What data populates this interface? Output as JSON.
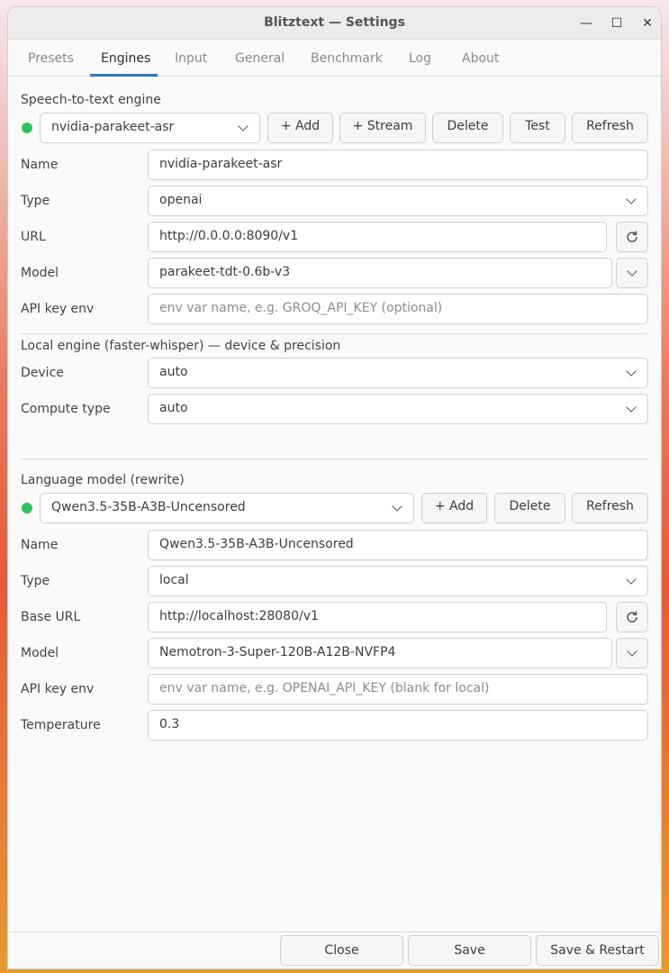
{
  "window": {
    "title": "Blitztext — Settings",
    "min_glyph": "—",
    "max_glyph": "☐",
    "close_glyph": "✕"
  },
  "tabs": [
    {
      "label": "Presets"
    },
    {
      "label": "Engines"
    },
    {
      "label": "Input"
    },
    {
      "label": "General"
    },
    {
      "label": "Benchmark"
    },
    {
      "label": "Log"
    },
    {
      "label": "About"
    }
  ],
  "stt": {
    "title": "Speech-to-text engine",
    "status_color": "#2fc35b",
    "selected": "nvidia-parakeet-asr",
    "buttons": {
      "add": "+ Add",
      "stream": "+ Stream",
      "delete": "Delete",
      "test": "Test",
      "refresh": "Refresh"
    },
    "name_label": "Name",
    "name_value": "nvidia-parakeet-asr",
    "type_label": "Type",
    "type_value": "openai",
    "url_label": "URL",
    "url_value": "http://0.0.0.0:8090/v1",
    "model_label": "Model",
    "model_value": "parakeet-tdt-0.6b-v3",
    "apikey_label": "API key env",
    "apikey_placeholder": "env var name, e.g. GROQ_API_KEY  (optional)"
  },
  "local": {
    "title": "Local engine (faster-whisper) — device & precision",
    "device_label": "Device",
    "device_value": "auto",
    "compute_label": "Compute type",
    "compute_value": "auto"
  },
  "llm": {
    "title": "Language model (rewrite)",
    "status_color": "#2fc35b",
    "selected": "Qwen3.5-35B-A3B-Uncensored",
    "buttons": {
      "add": "+ Add",
      "delete": "Delete",
      "refresh": "Refresh"
    },
    "name_label": "Name",
    "name_value": "Qwen3.5-35B-A3B-Uncensored",
    "type_label": "Type",
    "type_value": "local",
    "url_label": "Base URL",
    "url_value": "http://localhost:28080/v1",
    "model_label": "Model",
    "model_value": "Nemotron-3-Super-120B-A12B-NVFP4",
    "apikey_label": "API key env",
    "apikey_placeholder": "env var name, e.g. OPENAI_API_KEY  (blank for local)",
    "temp_label": "Temperature",
    "temp_value": "0.3"
  },
  "footer": {
    "close": "Close",
    "save": "Save",
    "save_restart": "Save & Restart"
  }
}
